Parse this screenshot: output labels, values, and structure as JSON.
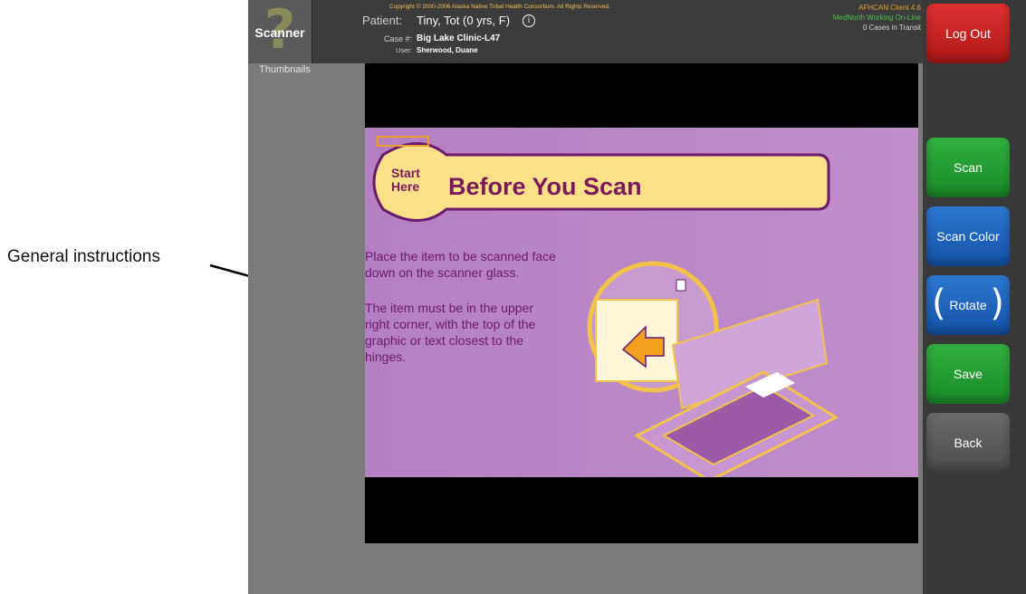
{
  "annotation": {
    "label": "General instructions"
  },
  "header": {
    "scanner_label": "Scanner",
    "thumbnails_label": "Thumbnails",
    "copyright": "Copyright © 2000-2006 Alaska Native Tribal Health Consortium. All Rights Reserved.",
    "patient_label": "Patient:",
    "patient_value": "Tiny, Tot (0 yrs, F)",
    "case_label": "Case #:",
    "case_value": "Big Lake Clinic-L47",
    "user_label": "User:",
    "user_value": "Sherwood, Duane",
    "client_version": "AFHCAN Client 4.6",
    "network_status": "MedNorth Working On-Line",
    "transit": "0 Cases in Transit"
  },
  "slide": {
    "start_line1": "Start",
    "start_line2": "Here",
    "heading": "Before You Scan",
    "para1_line1": "Place the item to be scanned face",
    "para1_line2": "down on the scanner glass.",
    "para2_line1": "The item must be in the upper",
    "para2_line2": "right corner, with the top of the",
    "para2_line3": "graphic or text closest to the",
    "para2_line4": "hinges."
  },
  "sidebar": {
    "logout": "Log Out",
    "scan": "Scan",
    "scan_color": "Scan Color",
    "rotate": "Rotate",
    "save": "Save",
    "back": "Back"
  },
  "colors": {
    "logout": "#d02424",
    "green": "#24a034",
    "blue": "#2066c0",
    "gray": "#5a5a5a",
    "slide": "#b886c4",
    "accent": "#f2c24a"
  }
}
